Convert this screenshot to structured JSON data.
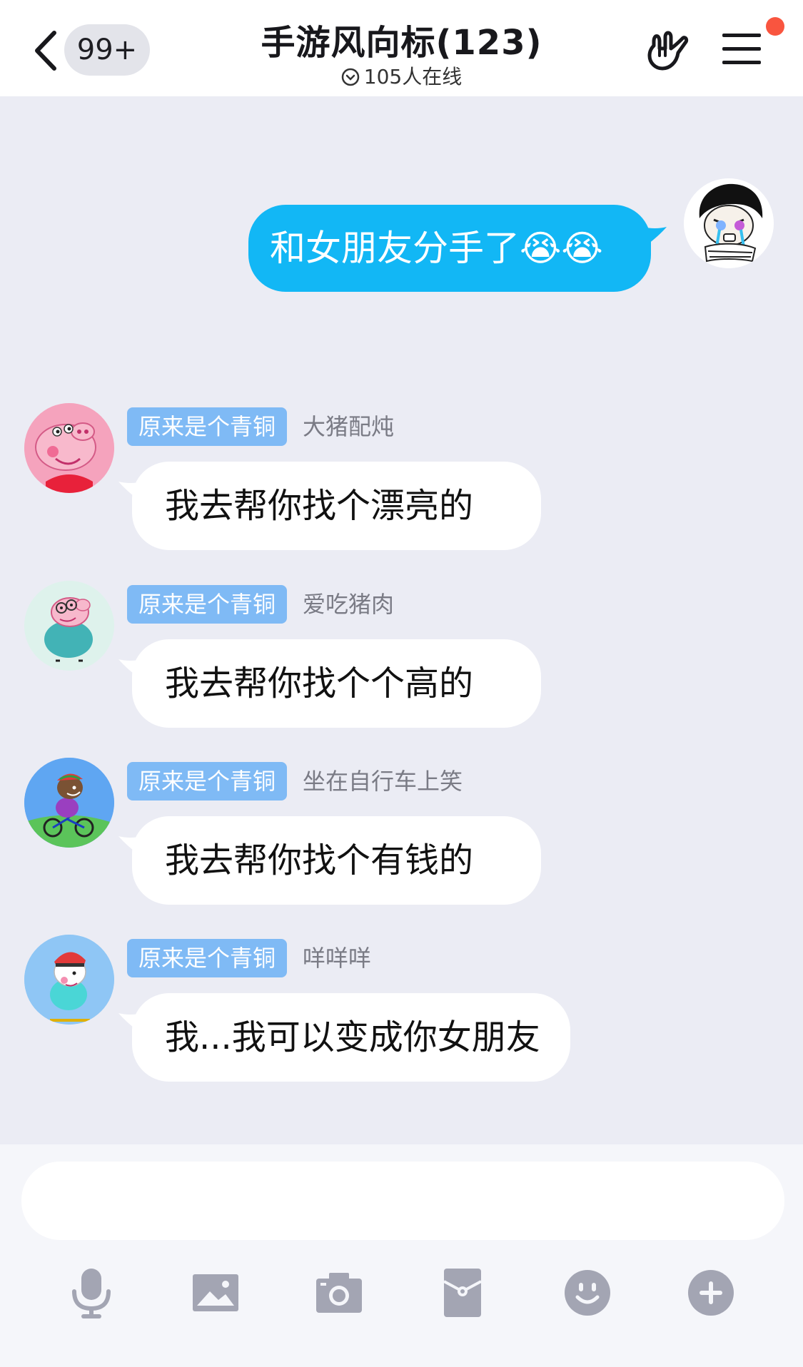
{
  "header": {
    "back_count": "99+",
    "title": "手游风向标(123)",
    "subtitle": "105人在线"
  },
  "my_message": {
    "text": "和女朋友分手了😭😭"
  },
  "messages": [
    {
      "tag": "原来是个青铜",
      "nickname": "大猪配炖",
      "text": "我去帮你找个漂亮的"
    },
    {
      "tag": "原来是个青铜",
      "nickname": "爱吃猪肉",
      "text": "我去帮你找个个高的"
    },
    {
      "tag": "原来是个青铜",
      "nickname": "坐在自行车上笑",
      "text": "我去帮你找个有钱的"
    },
    {
      "tag": "原来是个青铜",
      "nickname": "咩咩咩",
      "text": "我...我可以变成你女朋友"
    }
  ],
  "toolbar": {
    "icons": [
      "microphone-icon",
      "image-icon",
      "camera-icon",
      "red-packet-icon",
      "emoji-icon",
      "plus-icon"
    ]
  },
  "colors": {
    "accent": "#12b7f5",
    "tag": "#7fbaf5",
    "background": "#ebecf4",
    "icon": "#a3a5b3",
    "badge": "#f9553f"
  }
}
